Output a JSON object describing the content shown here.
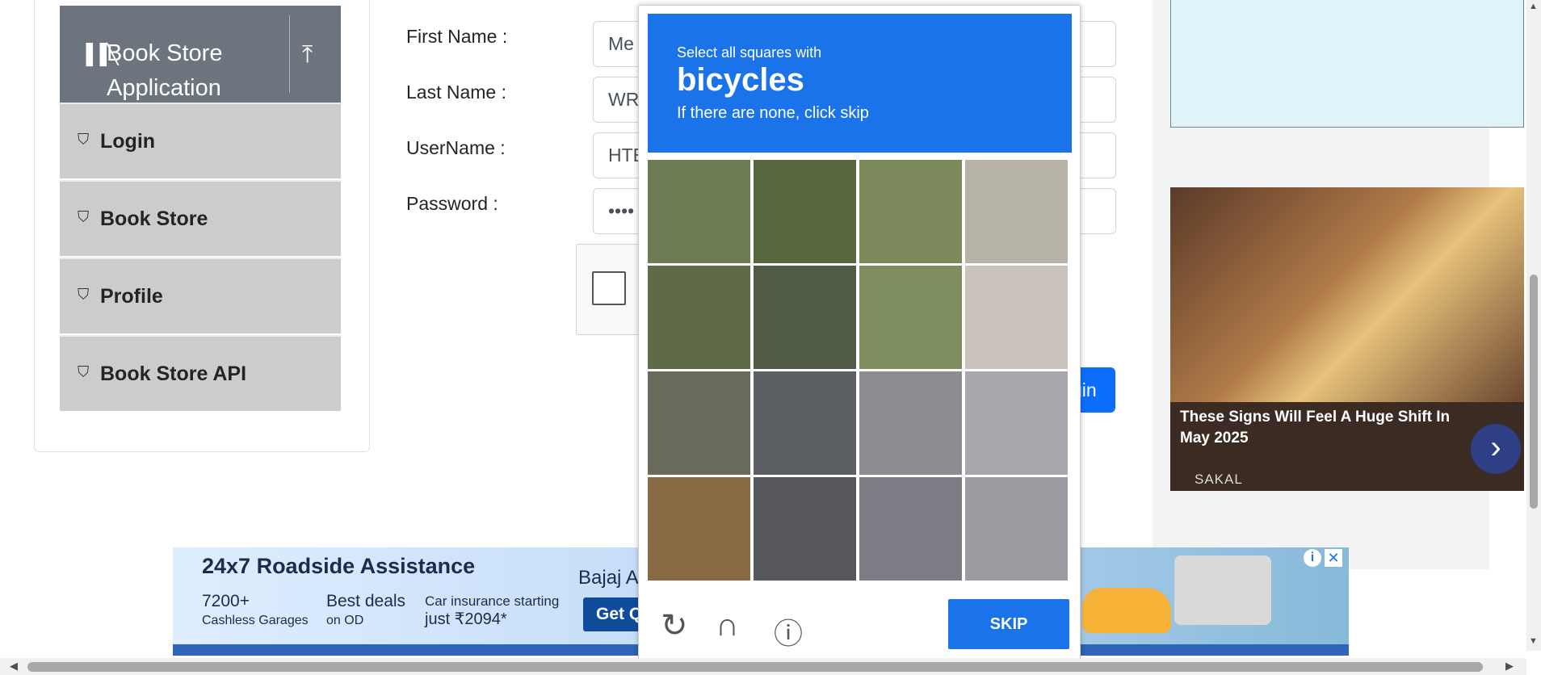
{
  "sidebar": {
    "group_title": "Book Store Application",
    "items": [
      {
        "label": "Login"
      },
      {
        "label": "Book Store"
      },
      {
        "label": "Profile"
      },
      {
        "label": "Book Store API"
      }
    ]
  },
  "form": {
    "first_name": {
      "label": "First Name :",
      "value": "Me"
    },
    "last_name": {
      "label": "Last Name :",
      "value": "WR"
    },
    "username": {
      "label": "UserName :",
      "value": "HTE"
    },
    "password": {
      "label": "Password :",
      "value": "••••"
    },
    "login_button_partial": "gin"
  },
  "captcha": {
    "prompt_line1": "Select all squares with",
    "target": "bicycles",
    "prompt_line3": "If there are none, click skip",
    "skip_label": "SKIP",
    "grid_rows": 4,
    "grid_cols": 4
  },
  "ads": {
    "right_caption": "These Signs Will Feel A Huge Shift In May 2025",
    "right_brand": "SAKAL",
    "bottom_headline": "24x7 Roadside Assistance",
    "bottom_f1_big": "7200+",
    "bottom_f1_small": "Cashless Garages",
    "bottom_f2_big": "Best deals",
    "bottom_f2_small": "on OD",
    "bottom_f3_line1": "Car insurance starting",
    "bottom_f3_line2": "just ₹2094*",
    "bottom_brand": "Bajaj Al",
    "bottom_cta": "Get Q"
  },
  "colors": {
    "accent": "#1a73e8",
    "header_gray": "#6c757d",
    "menu_gray": "#cccccc",
    "button_blue": "#0d6efd"
  },
  "icons": {
    "group": "books-icon",
    "collapse": "upload-icon",
    "menu": "html5-icon",
    "refresh": "refresh-icon",
    "audio": "headphones-icon",
    "info": "info-icon"
  }
}
